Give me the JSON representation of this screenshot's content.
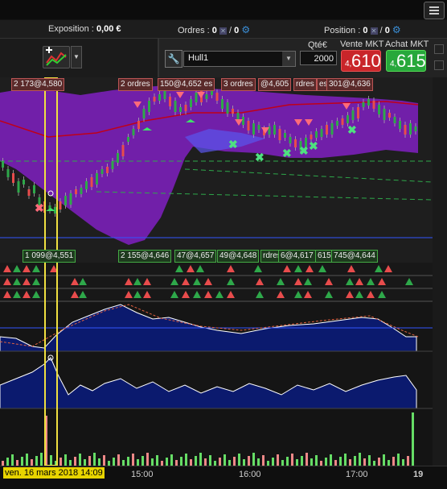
{
  "status": {
    "exposition_label": "Exposition :",
    "exposition_value": "0,00 €",
    "orders_label": "Ordres :",
    "orders_value1": "0",
    "orders_sep": "/",
    "orders_value2": "0",
    "position_label": "Position :",
    "position_value1": "0",
    "position_sep": "/",
    "position_value2": "0"
  },
  "trade": {
    "strategy": "Hull1",
    "qty_label": "Qté€",
    "qty": "2000",
    "sell_label": "Vente MKT",
    "buy_label": "Achat MKT",
    "sell_small": "4,",
    "sell_big": "610",
    "buy_small": "4,",
    "buy_big": "615"
  },
  "labels": {
    "top": [
      {
        "text": "2 173@4,580",
        "color": "red"
      },
      {
        "text": "2 ordres",
        "color": "red"
      },
      {
        "text": "150@4,652 es",
        "color": "red"
      },
      {
        "text": "3 ordres",
        "color": "red"
      },
      {
        "text": "@4,605",
        "color": "red"
      },
      {
        "text": "rdres",
        "color": "red"
      },
      {
        "text": "es",
        "color": "red"
      },
      {
        "text": "301@4,636",
        "color": "red"
      }
    ],
    "bottom": [
      {
        "text": "1 099@4,551",
        "color": "green"
      },
      {
        "text": "2 155@4,646",
        "color": "green"
      },
      {
        "text": "47@4,657",
        "color": "green"
      },
      {
        "text": "49@4,648",
        "color": "green"
      },
      {
        "text": "rdres",
        "color": "green"
      },
      {
        "text": "6@4,617",
        "color": "green"
      },
      {
        "text": "615",
        "color": "green"
      },
      {
        "text": "745@4,644",
        "color": "green"
      }
    ]
  },
  "time_axis": {
    "date_label": "ven. 16 mars 2018 14:09",
    "ticks": [
      "15:00",
      "16:00",
      "17:00"
    ],
    "last": "19"
  },
  "colors": {
    "bull": "#2ea84a",
    "bear": "#e84c4c",
    "band": "#7a1fb8",
    "cursor": "#f0e040",
    "accent": "#3b8fd8"
  }
}
